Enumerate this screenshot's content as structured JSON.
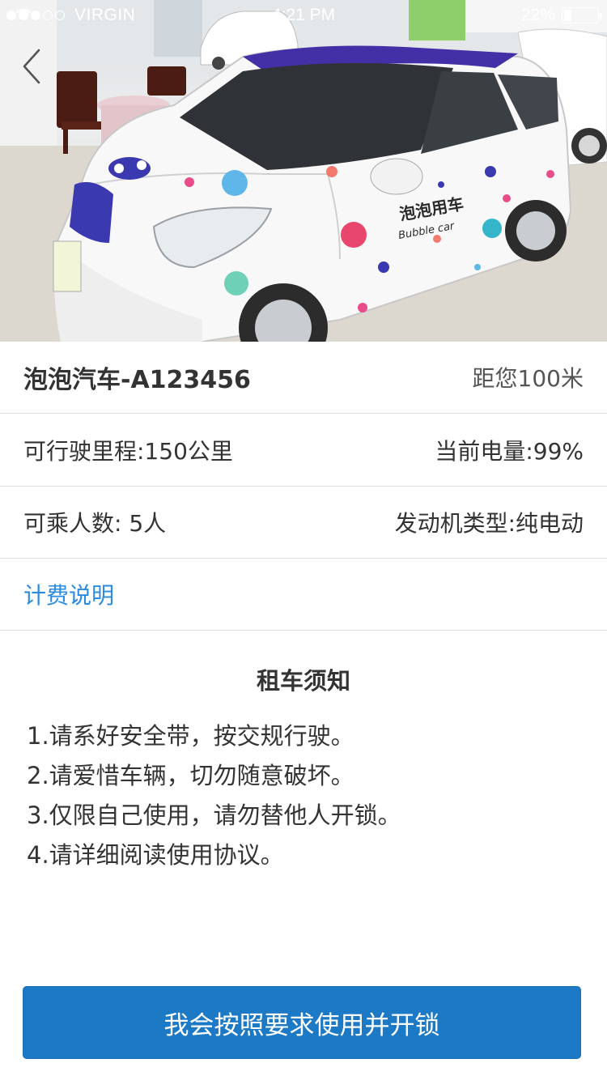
{
  "status_bar": {
    "carrier": "VIRGIN",
    "signal_bars_filled": 3,
    "signal_bars_total": 5,
    "time": "4:21 PM",
    "battery": "22%",
    "battery_level": 0.22
  },
  "nav": {
    "back_icon": "chevron-left-icon"
  },
  "hero": {
    "door_text_line1": "泡泡用车",
    "door_text_line2": "Bubble car"
  },
  "car": {
    "name": "泡泡汽车-A123456",
    "distance": "距您100米",
    "range": "可行驶里程:150公里",
    "battery": "当前电量:99%",
    "seats": "可乘人数: 5人",
    "engine": "发动机类型:纯电动"
  },
  "fee_link": "计费说明",
  "rules": {
    "title": "租车须知",
    "items": [
      "1.请系好安全带，按交规行驶。",
      "2.请爱惜车辆，切勿随意破坏。",
      "3.仅限自己使用，请勿替他人开锁。",
      "4.请详细阅读使用协议。"
    ]
  },
  "unlock_button": "我会按照要求使用并开锁",
  "colors": {
    "accent": "#1c79c5",
    "link": "#2a8be3",
    "divider": "#dedede",
    "text": "#333333"
  }
}
